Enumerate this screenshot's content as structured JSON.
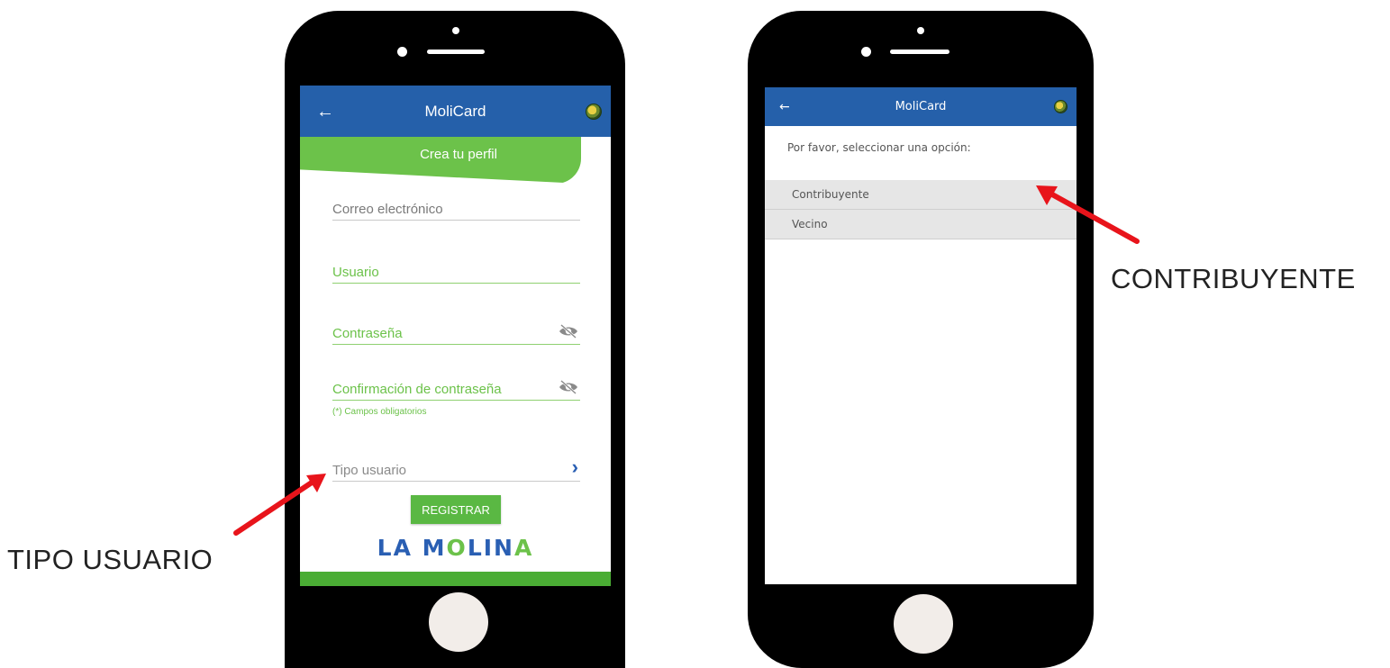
{
  "annotations": {
    "left_label": "TIPO USUARIO",
    "right_label": "CONTRIBUYENTE",
    "arrow_color": "#e8141b"
  },
  "register_screen": {
    "app_title": "MoliCard",
    "back_icon": "arrow-left-icon",
    "banner_label": "Crea tu perfil",
    "fields": {
      "email": "Correo electrónico",
      "username": "Usuario",
      "password": "Contraseña",
      "password_confirm": "Confirmación de contraseña",
      "user_type": "Tipo usuario"
    },
    "required_note": "(*) Campos obligatorios",
    "register_button": "REGISTRAR",
    "logo_text": {
      "part1": "LA M",
      "part2": "O",
      "part3": "LIN",
      "part4": "A"
    }
  },
  "select_screen": {
    "app_title": "MoliCard",
    "prompt": "Por favor, seleccionar una opción:",
    "options": [
      "Contribuyente",
      "Vecino"
    ]
  },
  "colors": {
    "appbar": "#2560aa",
    "accent_green": "#6cc24a",
    "button_green": "#5ab843"
  }
}
